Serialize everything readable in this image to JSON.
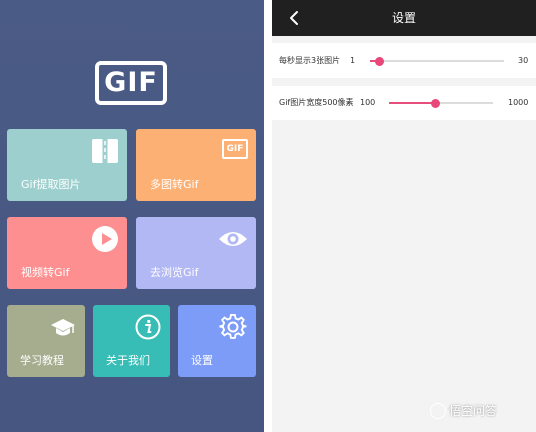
{
  "home": {
    "logo_text": "GIF",
    "tiles": [
      {
        "label": "Gif提取图片",
        "icon": "split-frame-icon"
      },
      {
        "label": "多图转Gif",
        "icon": "gif-badge-icon",
        "badge_text": "GIF"
      },
      {
        "label": "视频转Gif",
        "icon": "play-circle-icon"
      },
      {
        "label": "去浏览Gif",
        "icon": "eye-icon"
      },
      {
        "label": "学习教程",
        "icon": "graduation-cap-icon"
      },
      {
        "label": "关于我们",
        "icon": "info-icon"
      },
      {
        "label": "设置",
        "icon": "gear-icon"
      }
    ]
  },
  "settings": {
    "title": "设置",
    "back_icon": "chevron-left-icon",
    "sliders": [
      {
        "label": "每秒显示3张图片",
        "min": "1",
        "max": "30",
        "value": 3
      },
      {
        "label": "Gif图片宽度500像素",
        "min": "100",
        "max": "1000",
        "value": 500
      }
    ]
  },
  "colors": {
    "left_bg": "#4a5b85",
    "accent": "#e84e7c",
    "titlebar": "#202020"
  },
  "watermark": {
    "text": "悟空问答"
  }
}
